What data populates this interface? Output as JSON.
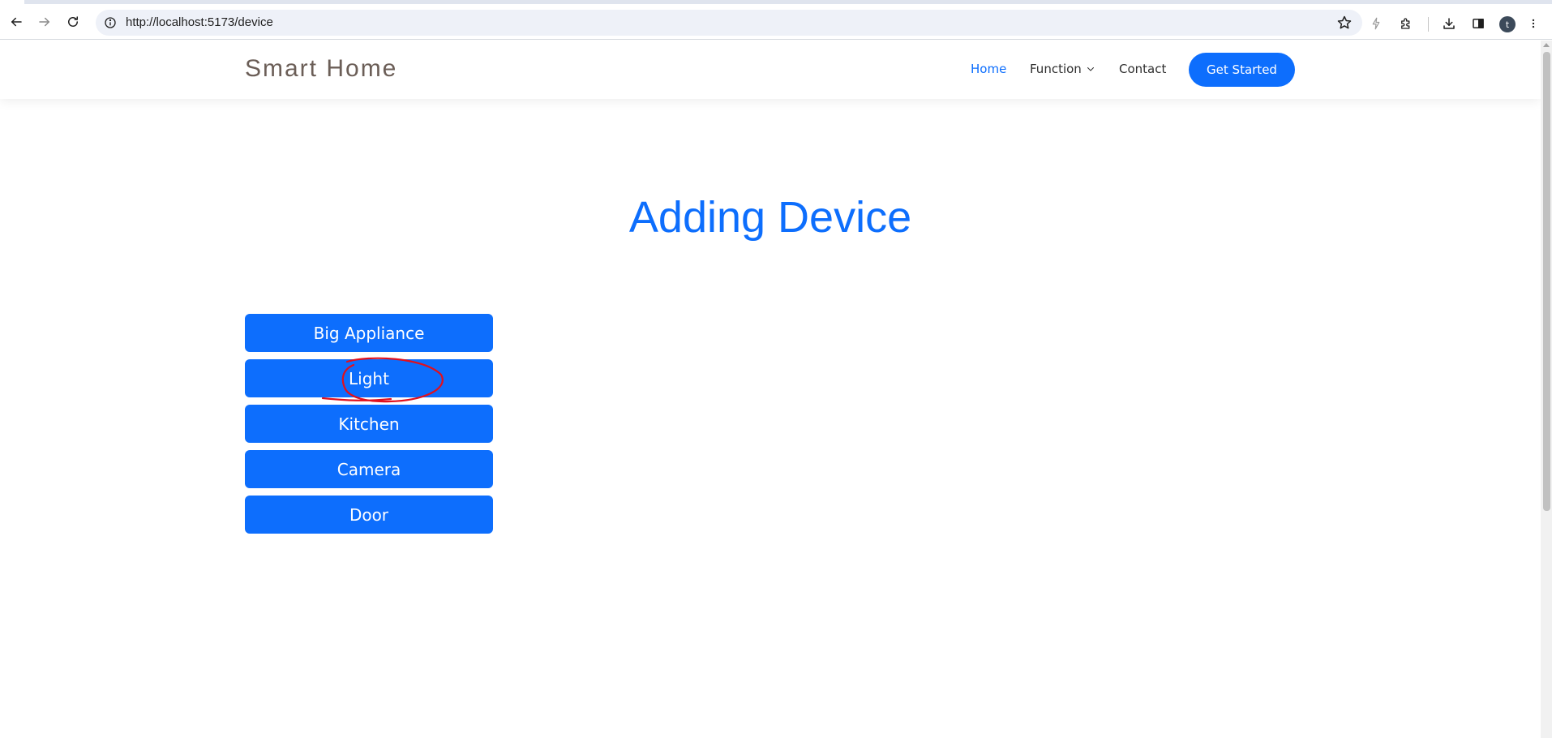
{
  "browser": {
    "url": "http://localhost:5173/device",
    "profile_initial": "t"
  },
  "header": {
    "brand": "Smart Home",
    "nav": {
      "home": "Home",
      "function": "Function",
      "contact": "Contact"
    },
    "cta": "Get Started"
  },
  "main": {
    "title": "Adding Device",
    "devices": [
      {
        "label": "Big Appliance"
      },
      {
        "label": "Light"
      },
      {
        "label": "Kitchen"
      },
      {
        "label": "Camera"
      },
      {
        "label": "Door"
      }
    ]
  },
  "colors": {
    "accent": "#0d6efd",
    "brand_text": "#6b5e57",
    "annotation": "#e0101e"
  },
  "icons": {
    "back": "arrow-left-icon",
    "forward": "arrow-right-icon",
    "reload": "reload-icon",
    "site_info": "info-icon",
    "bookmark": "star-icon",
    "performance": "lightning-icon",
    "extensions": "puzzle-icon",
    "downloads": "download-icon",
    "side_panel": "side-panel-icon",
    "menu": "kebab-menu-icon",
    "dropdown": "chevron-down-icon"
  }
}
